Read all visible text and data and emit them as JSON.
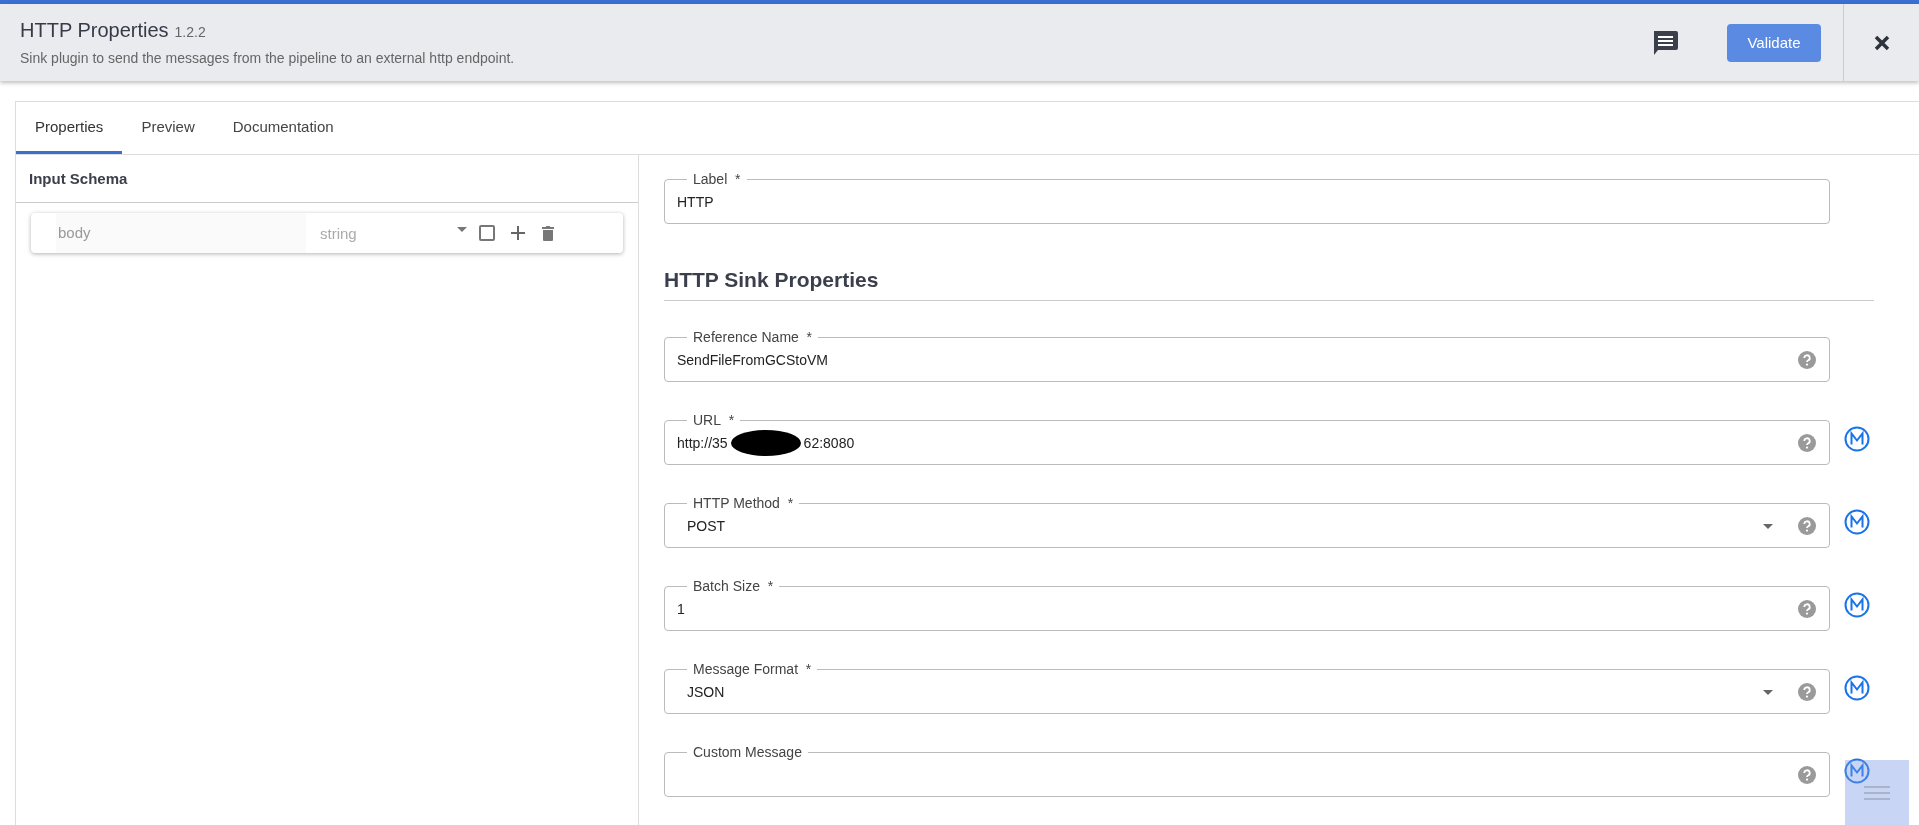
{
  "header": {
    "title": "HTTP Properties",
    "version": "1.2.2",
    "description": "Sink plugin to send the messages from the pipeline to an external http endpoint.",
    "validate_button": "Validate"
  },
  "tabs": [
    {
      "label": "Properties",
      "selected": true
    },
    {
      "label": "Preview",
      "selected": false
    },
    {
      "label": "Documentation",
      "selected": false
    }
  ],
  "input_schema": {
    "title": "Input Schema",
    "fields": [
      {
        "name": "body",
        "type": "string",
        "nullable": false
      }
    ]
  },
  "label_field": {
    "label": "Label",
    "required_mark": "*",
    "value": "HTTP"
  },
  "section_title": "HTTP Sink Properties",
  "properties": [
    {
      "kind": "text",
      "label": "Reference Name",
      "required_mark": "*",
      "value": "SendFileFromGCStoVM",
      "help": true,
      "macro": false
    },
    {
      "kind": "redacted",
      "label": "URL",
      "required_mark": "*",
      "value_start": "http://35",
      "value_end": "62:8080",
      "help": true,
      "macro": true
    },
    {
      "kind": "select",
      "label": "HTTP Method",
      "required_mark": "*",
      "value": "POST",
      "help": true,
      "macro": true
    },
    {
      "kind": "text",
      "label": "Batch Size",
      "required_mark": "*",
      "value": "1",
      "help": true,
      "macro": true
    },
    {
      "kind": "select",
      "label": "Message Format",
      "required_mark": "*",
      "value": "JSON",
      "help": true,
      "macro": true
    },
    {
      "kind": "text",
      "label": "Custom Message",
      "help": true,
      "macro": true
    }
  ]
}
